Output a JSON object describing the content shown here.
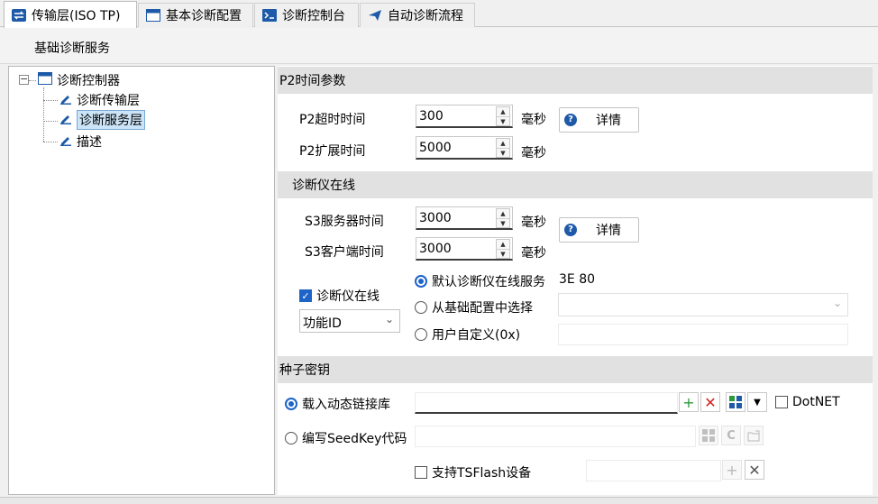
{
  "tabs": [
    {
      "label": "传输层(ISO TP)",
      "icon": "swap-arrows-icon"
    },
    {
      "label": "基本诊断配置",
      "icon": "window-icon"
    },
    {
      "label": "诊断控制台",
      "icon": "console-icon"
    },
    {
      "label": "自动诊断流程",
      "icon": "send-icon"
    }
  ],
  "sub_header": "基础诊断服务",
  "tree": {
    "root": "诊断控制器",
    "children": [
      "诊断传输层",
      "诊断服务层",
      "描述"
    ],
    "selected": "诊断服务层"
  },
  "p2": {
    "title": "P2时间参数",
    "timeout_label": "P2超时时间",
    "timeout_value": "300",
    "ext_label": "P2扩展时间",
    "ext_value": "5000",
    "unit": "毫秒",
    "details": "详情"
  },
  "tester": {
    "title": "诊断仪在线",
    "s3_server_label": "S3服务器时间",
    "s3_server_value": "3000",
    "s3_client_label": "S3客户端时间",
    "s3_client_value": "3000",
    "unit": "毫秒",
    "details": "详情",
    "online_checkbox": "诊断仪在线",
    "id_select": "功能ID",
    "radio_default": "默认诊断仪在线服务",
    "default_value": "3E 80",
    "radio_from_config": "从基础配置中选择",
    "radio_custom": "用户自定义(0x)"
  },
  "seed": {
    "title": "种子密钥",
    "radio_dll": "载入动态链接库",
    "radio_code": "编写SeedKey代码",
    "dotnet": "DotNET",
    "tsflash": "支持TSFlash设备"
  },
  "colors": {
    "accent": "#1e64c8",
    "section_bg": "#e1e1e1"
  }
}
